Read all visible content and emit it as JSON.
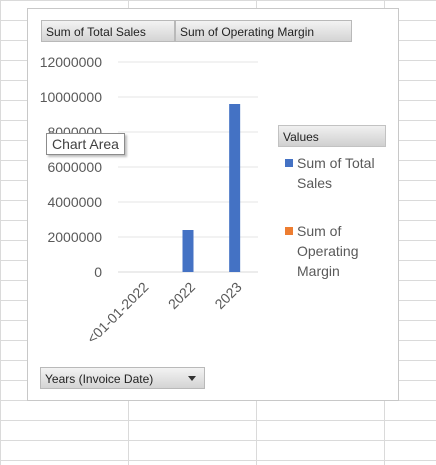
{
  "field_buttons": {
    "sales": "Sum of Total Sales",
    "margin": "Sum of Operating Margin",
    "years": "Years (Invoice Date)"
  },
  "legend": {
    "title": "Values",
    "entries": [
      "Sum of Total Sales",
      "Sum of Operating Margin"
    ]
  },
  "tooltip": "Chart Area",
  "colors": {
    "sales": "#4472C4",
    "margin": "#ED7D31"
  },
  "chart_data": {
    "type": "bar",
    "categories": [
      "<01-01-2022",
      "2022",
      "2023"
    ],
    "series": [
      {
        "name": "Sum of Total Sales",
        "values": [
          0,
          2400000,
          9600000
        ]
      },
      {
        "name": "Sum of Operating Margin",
        "values": [
          0,
          0,
          0
        ]
      }
    ],
    "y_ticks": [
      "0",
      "2000000",
      "4000000",
      "6000000",
      "8000000",
      "10000000",
      "12000000"
    ],
    "ylim": [
      0,
      12000000
    ],
    "grid": true,
    "legend_position": "right"
  }
}
